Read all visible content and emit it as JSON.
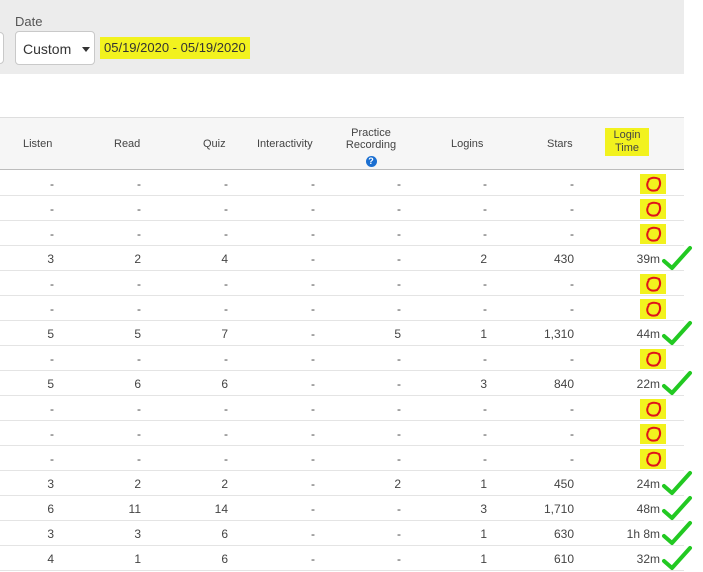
{
  "filter": {
    "date_label": "Date",
    "range_select_value": "Custom",
    "date_range": "05/19/2020 - 05/19/2020",
    "highlight_color": "#f2f21e"
  },
  "table": {
    "headers": {
      "listen": "Listen",
      "read": "Read",
      "quiz": "Quiz",
      "interactivity": "Interactivity",
      "practice_recording_line1": "Practice",
      "practice_recording_line2": "Recording",
      "logins": "Logins",
      "stars": "Stars",
      "login_time_line1": "Login",
      "login_time_line2": "Time"
    },
    "rows": [
      {
        "listen": "-",
        "read": "-",
        "quiz": "-",
        "interactivity": "-",
        "practice": "-",
        "logins": "-",
        "stars": "-",
        "login_time": "",
        "annotation": "red-scribble"
      },
      {
        "listen": "-",
        "read": "-",
        "quiz": "-",
        "interactivity": "-",
        "practice": "-",
        "logins": "-",
        "stars": "-",
        "login_time": "",
        "annotation": "red-scribble"
      },
      {
        "listen": "-",
        "read": "-",
        "quiz": "-",
        "interactivity": "-",
        "practice": "-",
        "logins": "-",
        "stars": "-",
        "login_time": "",
        "annotation": "red-scribble"
      },
      {
        "listen": "3",
        "read": "2",
        "quiz": "4",
        "interactivity": "-",
        "practice": "-",
        "logins": "2",
        "stars": "430",
        "login_time": "39m",
        "annotation": "green-check"
      },
      {
        "listen": "-",
        "read": "-",
        "quiz": "-",
        "interactivity": "-",
        "practice": "-",
        "logins": "-",
        "stars": "-",
        "login_time": "",
        "annotation": "red-scribble"
      },
      {
        "listen": "-",
        "read": "-",
        "quiz": "-",
        "interactivity": "-",
        "practice": "-",
        "logins": "-",
        "stars": "-",
        "login_time": "",
        "annotation": "red-scribble"
      },
      {
        "listen": "5",
        "read": "5",
        "quiz": "7",
        "interactivity": "-",
        "practice": "5",
        "logins": "1",
        "stars": "1,310",
        "login_time": "44m",
        "annotation": "green-check"
      },
      {
        "listen": "-",
        "read": "-",
        "quiz": "-",
        "interactivity": "-",
        "practice": "-",
        "logins": "-",
        "stars": "-",
        "login_time": "",
        "annotation": "red-scribble"
      },
      {
        "listen": "5",
        "read": "6",
        "quiz": "6",
        "interactivity": "-",
        "practice": "-",
        "logins": "3",
        "stars": "840",
        "login_time": "22m",
        "annotation": "green-check"
      },
      {
        "listen": "-",
        "read": "-",
        "quiz": "-",
        "interactivity": "-",
        "practice": "-",
        "logins": "-",
        "stars": "-",
        "login_time": "",
        "annotation": "red-scribble"
      },
      {
        "listen": "-",
        "read": "-",
        "quiz": "-",
        "interactivity": "-",
        "practice": "-",
        "logins": "-",
        "stars": "-",
        "login_time": "",
        "annotation": "red-scribble"
      },
      {
        "listen": "-",
        "read": "-",
        "quiz": "-",
        "interactivity": "-",
        "practice": "-",
        "logins": "-",
        "stars": "-",
        "login_time": "",
        "annotation": "red-scribble"
      },
      {
        "listen": "3",
        "read": "2",
        "quiz": "2",
        "interactivity": "-",
        "practice": "2",
        "logins": "1",
        "stars": "450",
        "login_time": "24m",
        "annotation": "green-check"
      },
      {
        "listen": "6",
        "read": "11",
        "quiz": "14",
        "interactivity": "-",
        "practice": "-",
        "logins": "3",
        "stars": "1,710",
        "login_time": "48m",
        "annotation": "green-check"
      },
      {
        "listen": "3",
        "read": "3",
        "quiz": "6",
        "interactivity": "-",
        "practice": "-",
        "logins": "1",
        "stars": "630",
        "login_time": "1h 8m",
        "annotation": "green-check"
      },
      {
        "listen": "4",
        "read": "1",
        "quiz": "6",
        "interactivity": "-",
        "practice": "-",
        "logins": "1",
        "stars": "610",
        "login_time": "32m",
        "annotation": "green-check"
      }
    ]
  },
  "annotation_colors": {
    "highlight": "#f2f21e",
    "scribble": "#e0141a",
    "check": "#22c922"
  }
}
